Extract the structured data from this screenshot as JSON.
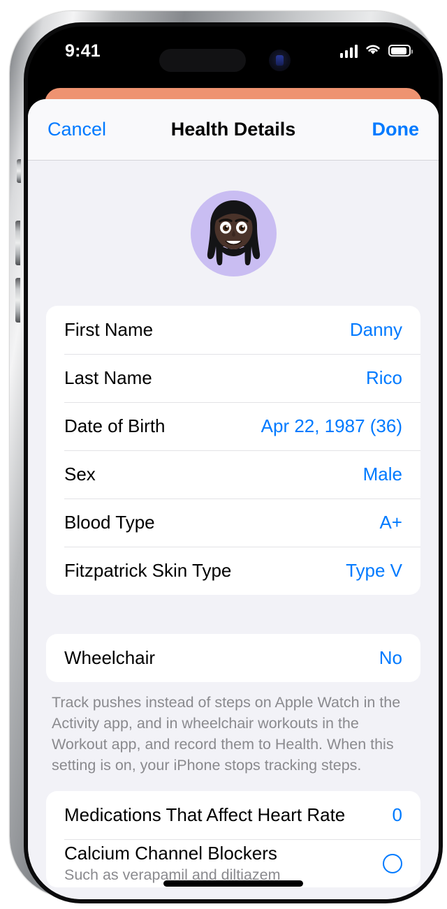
{
  "status_bar": {
    "time": "9:41",
    "cellular_icon": "cellular-signal-icon",
    "wifi_icon": "wifi-icon",
    "battery_icon": "battery-icon"
  },
  "nav": {
    "cancel_label": "Cancel",
    "title": "Health Details",
    "done_label": "Done"
  },
  "avatar": {
    "icon": "memoji-avatar",
    "background_color": "#c9bdf2"
  },
  "colors": {
    "accent_blue": "#007aff",
    "sheet_background": "#f2f2f7",
    "card_background": "#ffffff",
    "behind_card_orange": "#ee9371",
    "secondary_text": "#8a8a8e"
  },
  "profile_section": {
    "rows": [
      {
        "label": "First Name",
        "value": "Danny"
      },
      {
        "label": "Last Name",
        "value": "Rico"
      },
      {
        "label": "Date of Birth",
        "value": "Apr 22, 1987 (36)"
      },
      {
        "label": "Sex",
        "value": "Male"
      },
      {
        "label": "Blood Type",
        "value": "A+"
      },
      {
        "label": "Fitzpatrick Skin Type",
        "value": "Type V"
      }
    ]
  },
  "wheelchair_section": {
    "rows": [
      {
        "label": "Wheelchair",
        "value": "No"
      }
    ],
    "footer": "Track pushes instead of steps on Apple Watch in the Activity app, and in wheelchair workouts in the Workout app, and record them to Health. When this setting is on, your iPhone stops tracking steps."
  },
  "medications_section": {
    "rows": [
      {
        "label": "Medications That Affect Heart Rate",
        "value": "0"
      },
      {
        "label": "Calcium Channel Blockers",
        "sub": "Such as verapamil and diltiazem",
        "value": "",
        "control": "radio-unchecked"
      }
    ]
  }
}
